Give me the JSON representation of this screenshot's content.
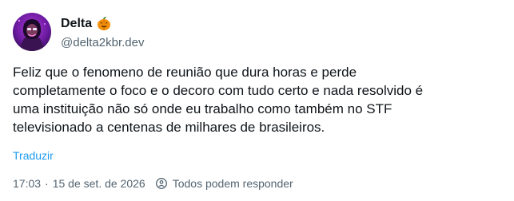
{
  "author": {
    "display_name": "Delta",
    "name_emoji": "jack-o-lantern-icon",
    "handle": "@delta2kbr.dev"
  },
  "post": {
    "lines": [
      "Feliz que o fenomeno de reunião que dura horas e perde",
      "completamente o foco e o decoro com tudo certo e nada resolvido é",
      "uma instituição não só onde eu trabalho como também no STF",
      "televisionado a centenas de milhares de brasileiros."
    ],
    "translate_label": "Traduzir"
  },
  "meta": {
    "time": "17:03",
    "separator": "·",
    "date": "15 de set. de 2026",
    "reply_icon": "reply-settings-icon",
    "reply_setting": "Todos podem responder"
  },
  "colors": {
    "text_primary": "#0f1419",
    "text_secondary": "#536471",
    "link": "#1d9bf0"
  }
}
